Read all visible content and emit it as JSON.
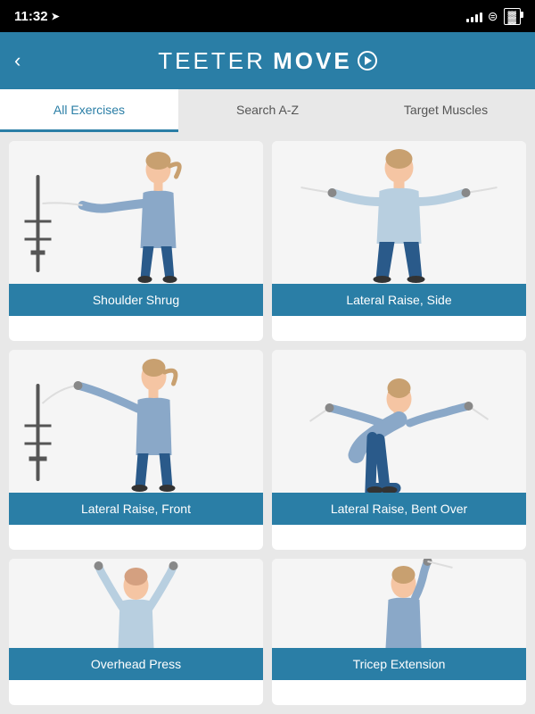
{
  "status": {
    "time": "11:32",
    "location_icon": "▶",
    "signal": [
      3,
      5,
      7,
      10,
      12
    ],
    "wifi": "wifi",
    "battery": "battery"
  },
  "header": {
    "logo_teeter": "TEETER",
    "logo_move": "MOVE",
    "back_label": "‹"
  },
  "tabs": [
    {
      "id": "all",
      "label": "All Exercises",
      "active": true
    },
    {
      "id": "az",
      "label": "Search A-Z",
      "active": false
    },
    {
      "id": "muscles",
      "label": "Target Muscles",
      "active": false
    }
  ],
  "exercises": [
    {
      "id": 1,
      "name": "Shoulder Shrug",
      "figure_type": "shoulder_shrug"
    },
    {
      "id": 2,
      "name": "Lateral Raise, Side",
      "figure_type": "lateral_raise_side"
    },
    {
      "id": 3,
      "name": "Lateral Raise, Front",
      "figure_type": "lateral_raise_front"
    },
    {
      "id": 4,
      "name": "Lateral Raise, Bent Over",
      "figure_type": "lateral_raise_bent"
    },
    {
      "id": 5,
      "name": "Overhead Press",
      "figure_type": "overhead_partial"
    },
    {
      "id": 6,
      "name": "Tricep Extension",
      "figure_type": "tricep_partial"
    }
  ],
  "colors": {
    "primary": "#2a7ea6",
    "background": "#e8e8e8",
    "tab_active_bg": "#ffffff",
    "card_bg": "#ffffff",
    "status_bar": "#000000"
  }
}
